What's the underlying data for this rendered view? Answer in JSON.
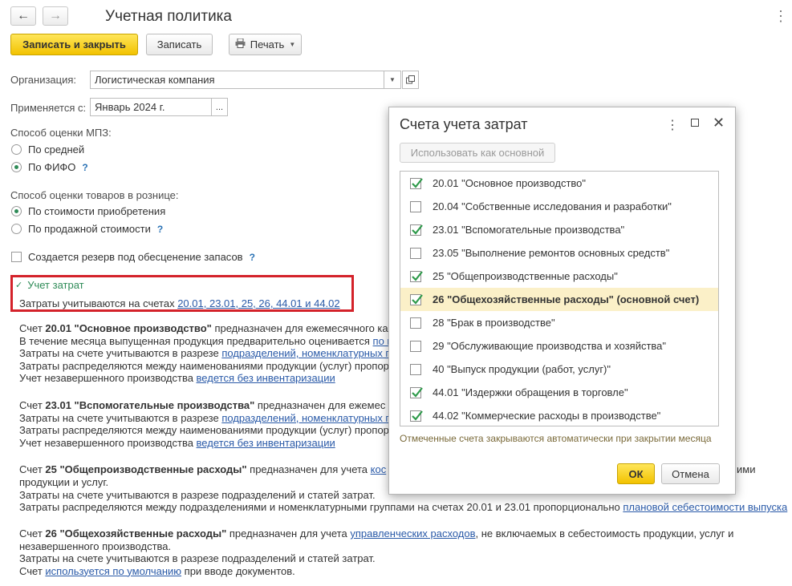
{
  "header": {
    "title": "Учетная политика",
    "back_icon": "←",
    "forward_icon": "→",
    "more_icon": "⋮"
  },
  "toolbar": {
    "save_close": "Записать и закрыть",
    "save": "Записать",
    "print": "Печать"
  },
  "form": {
    "org_label": "Организация:",
    "org_value": "Логистическая компания",
    "applies_label": "Применяется с:",
    "applies_value": "Январь 2024 г.",
    "applies_btn": "...",
    "mpz_label": "Способ оценки МПЗ:",
    "mpz_opt1": "По средней",
    "mpz_opt2": "По ФИФО",
    "retail_label": "Способ оценки товаров в рознице:",
    "retail_opt1": "По стоимости приобретения",
    "retail_opt2": "По продажной стоимости",
    "reserve_label": "Создается резерв под обесценение запасов",
    "help_mark": "?"
  },
  "cost": {
    "group_title": "Учет затрат",
    "accounts_prefix": "Затраты учитываются на счетах",
    "accounts_link": "20.01, 23.01, 25, 26, 44.01 и 44.02"
  },
  "desc": {
    "b1_l1a": "Счет ",
    "b1_l1b": "20.01 \"Основное производство\"",
    "b1_l1c": " предназначен для ежемесячного ка",
    "b1_l2a": "В течение месяца выпущенная продукция предварительно оценивается ",
    "b1_l2b": "по п",
    "b1_l3a": "Затраты на счете учитываются в разрезе ",
    "b1_l3b": "подразделений, номенклатурных г",
    "b1_l4": "Затраты распределяются между наименованиями продукции (услуг) пропор",
    "b1_l5a": "Учет незавершенного производства ",
    "b1_l5b": "ведется без инвентаризации",
    "b2_l1a": "Счет ",
    "b2_l1b": "23.01 \"Вспомогательные производства\"",
    "b2_l1c": " предназначен для ежемес",
    "b2_l2a": "Затраты на счете учитываются в разрезе ",
    "b2_l2b": "подразделений, номенклатурных г",
    "b2_l3": "Затраты распределяются между наименованиями продукции (услуг) пропор",
    "b2_l4a": "Учет незавершенного производства ",
    "b2_l4b": "ведется без инвентаризации",
    "b3_l1a": "Счет ",
    "b3_l1b": "25 \"Общепроизводственные расходы\"",
    "b3_l1c": " предназначен для учета ",
    "b3_l1d": "кос",
    "b3_l1e": "ими",
    "b3_l2": "продукции и услуг.",
    "b3_l3": "Затраты на счете учитываются в разрезе подразделений и статей затрат.",
    "b3_l4a": "Затраты распределяются между подразделениями и номенклатурными группами на счетах 20.01 и 23.01 пропорционально ",
    "b3_l4b": "плановой себестоимости выпуска",
    "b4_l1a": "Счет ",
    "b4_l1b": "26 \"Общехозяйственные расходы\"",
    "b4_l1c": " предназначен для учета ",
    "b4_l1d": "управленческих расходов",
    "b4_l1e": ", не включаемых в себестоимость продукции, услуг и",
    "b4_l2": "незавершенного производства.",
    "b4_l3": "Затраты на счете учитываются в разрезе подразделений и статей затрат.",
    "b4_l4a": "Счет ",
    "b4_l4b": "используется по умолчанию",
    "b4_l4c": " при вводе документов."
  },
  "dialog": {
    "title": "Счета учета затрат",
    "use_main": "Использовать как основной",
    "accounts": [
      {
        "label": "20.01 \"Основное производство\"",
        "checked": true
      },
      {
        "label": "20.04 \"Собственные исследования и разработки\"",
        "checked": false
      },
      {
        "label": "23.01 \"Вспомогательные производства\"",
        "checked": true
      },
      {
        "label": "23.05 \"Выполнение ремонтов основных средств\"",
        "checked": false
      },
      {
        "label": "25 \"Общепроизводственные расходы\"",
        "checked": true
      },
      {
        "label": "26 \"Общехозяйственные расходы\" (основной счет)",
        "checked": true,
        "selected": true
      },
      {
        "label": "28 \"Брак в производстве\"",
        "checked": false
      },
      {
        "label": "29 \"Обслуживающие производства и хозяйства\"",
        "checked": false
      },
      {
        "label": "40 \"Выпуск продукции (работ, услуг)\"",
        "checked": false
      },
      {
        "label": "44.01 \"Издержки обращения в торговле\"",
        "checked": true
      },
      {
        "label": "44.02 \"Коммерческие расходы в производстве\"",
        "checked": true
      }
    ],
    "note": "Отмеченные счета закрываются автоматически при закрытии месяца",
    "ok": "ОК",
    "cancel": "Отмена"
  },
  "colors": {
    "accent_yellow": "#f2c200",
    "check_green": "#2e9a4a",
    "highlight_red": "#d4222a",
    "link_blue": "#2a5aa8"
  }
}
